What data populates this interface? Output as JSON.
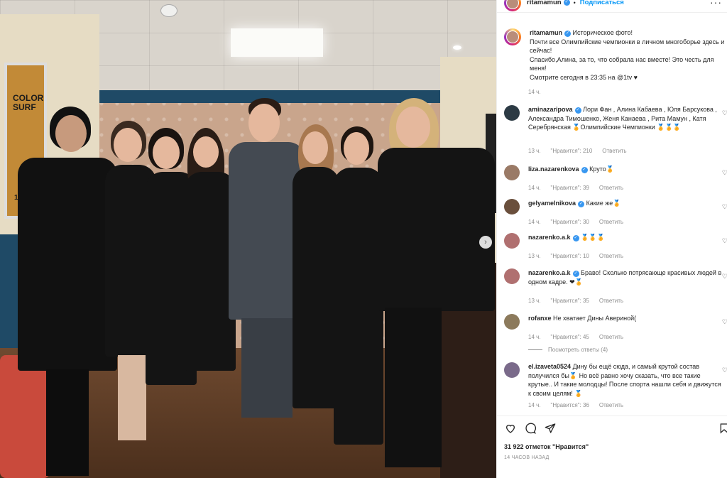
{
  "post": {
    "username": "ritamamun",
    "follow_label": "Подписаться",
    "caption_lines": [
      "Историческое фото!",
      "Почти все Олимпийские чемпионки в личном многоборье здесь и сейчас!",
      "Спасибо,Алина, за то, что собрала нас вместе! Это честь для меня!",
      "Смотрите сегодня в 23:35 на @1tv ♥"
    ],
    "caption_time": "14 ч.",
    "likes": "31 922 отметок \"Нравится\"",
    "posted_ago": "14 ЧАСОВ НАЗАД"
  },
  "photo": {
    "poster_title": "COLOR\nSURF",
    "poster_year": "1979",
    "next_icon": "chevron-right-icon"
  },
  "comments": [
    {
      "user": "aminazaripova",
      "verified": true,
      "text": "Лори Фан , Алина Кабаева , Юля Барсукова , Александра Тимошенко, Женя Канаева , Рита Мамун , Катя Серебрянская 🏅Олимпийские Чемпионки 🏅🏅🏅",
      "time": "13 ч.",
      "likes": "\"Нравится\": 210",
      "reply": "Ответить",
      "color": "#2c3a44"
    },
    {
      "user": "liza.nazarenkova",
      "verified": true,
      "text": "Круто🏅",
      "time": "14 ч.",
      "likes": "\"Нравится\": 39",
      "reply": "Ответить",
      "color": "#9a7a66"
    },
    {
      "user": "gelyamelnikova",
      "verified": true,
      "text": "Какие же🏅",
      "time": "14 ч.",
      "likes": "\"Нравится\": 30",
      "reply": "Ответить",
      "color": "#6a4f3c"
    },
    {
      "user": "nazarenko.a.k",
      "verified": true,
      "text": "🏅🏅🏅",
      "time": "13 ч.",
      "likes": "\"Нравится\": 10",
      "reply": "Ответить",
      "color": "#b07070"
    },
    {
      "user": "nazarenko.a.k",
      "verified": true,
      "text": "Браво! Сколько потрясающе красивых людей в одном кадре. ❤🏅",
      "time": "13 ч.",
      "likes": "\"Нравится\": 35",
      "reply": "Ответить",
      "color": "#b07070"
    },
    {
      "user": "rofanxe",
      "verified": false,
      "text": "Не хватает Дины Авериной(",
      "time": "14 ч.",
      "likes": "\"Нравится\": 45",
      "reply": "Ответить",
      "color": "#8c7a5c"
    },
    {
      "user": "el.izaveta0524",
      "verified": false,
      "text": "Дину бы ещё сюда, и самый крутой состав получился бы🏅 Но всё равно хочу сказать, что все такие крутые.. И такие молодцы! После спорта нашли себя и движутся к своим целям! 🏅",
      "time": "14 ч.",
      "likes": "\"Нравится\": 36",
      "reply": "Ответить",
      "color": "#7a6a8a"
    }
  ],
  "view_replies": "Посмотреть ответы (4)",
  "icons": {
    "like": "heart-icon",
    "comment": "comment-icon",
    "share": "share-icon",
    "save": "bookmark-icon",
    "more": "more-icon"
  }
}
